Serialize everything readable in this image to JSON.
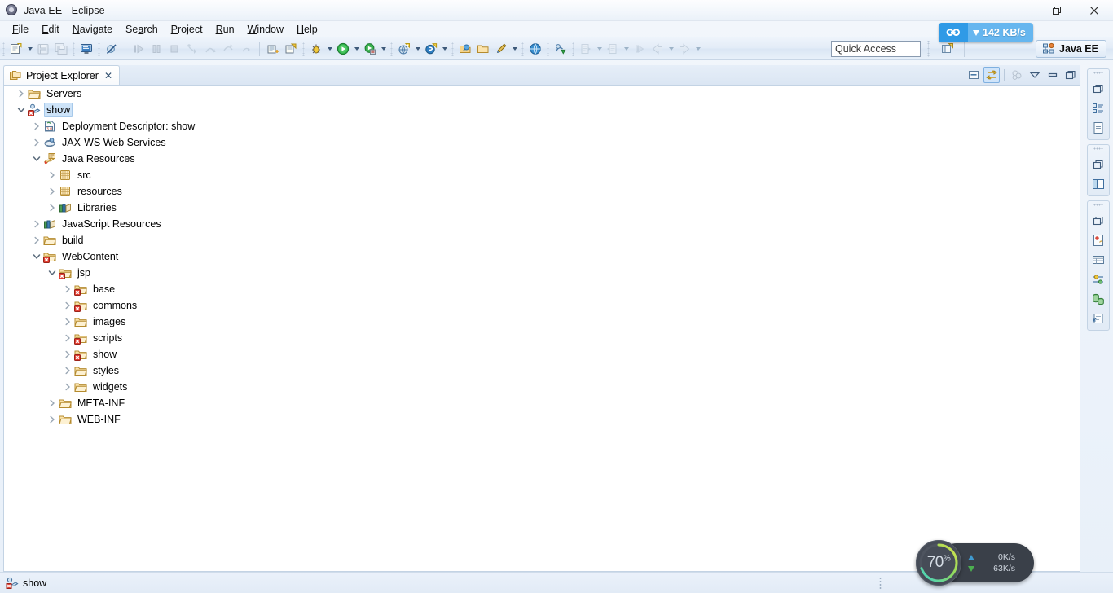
{
  "window": {
    "title": "Java EE - Eclipse",
    "app_icon": "eclipse-logo-icon",
    "minimize_label": "Minimize",
    "maximize_label": "Restore",
    "close_label": "Close"
  },
  "menubar": {
    "items": [
      {
        "label": "File",
        "mnemonic": "F"
      },
      {
        "label": "Edit",
        "mnemonic": "E"
      },
      {
        "label": "Navigate",
        "mnemonic": "N"
      },
      {
        "label": "Search",
        "mnemonic": "a"
      },
      {
        "label": "Project",
        "mnemonic": "P"
      },
      {
        "label": "Run",
        "mnemonic": "R"
      },
      {
        "label": "Window",
        "mnemonic": "W"
      },
      {
        "label": "Help",
        "mnemonic": "H"
      }
    ]
  },
  "toolbar": {
    "groups": [
      {
        "items": [
          {
            "name": "new-wizard-icon",
            "tip": "New",
            "enabled": true,
            "dropdown": true
          },
          {
            "name": "save-icon",
            "tip": "Save",
            "enabled": false,
            "dropdown": false
          },
          {
            "name": "save-all-icon",
            "tip": "Save All",
            "enabled": false,
            "dropdown": false
          }
        ]
      },
      {
        "items": [
          {
            "name": "console-icon",
            "tip": "Open Console",
            "enabled": true,
            "dropdown": false
          }
        ]
      },
      {
        "items": [
          {
            "name": "skip-breakpoints-icon",
            "tip": "Skip All Breakpoints",
            "enabled": true,
            "dropdown": false
          }
        ]
      },
      {
        "items": [
          {
            "name": "resume-icon",
            "tip": "Resume",
            "enabled": false,
            "dropdown": false
          },
          {
            "name": "suspend-icon",
            "tip": "Suspend",
            "enabled": false,
            "dropdown": false
          },
          {
            "name": "terminate-icon",
            "tip": "Terminate",
            "enabled": false,
            "dropdown": false
          },
          {
            "name": "step-into-icon",
            "tip": "Step Into",
            "enabled": false,
            "dropdown": false
          },
          {
            "name": "step-over-icon",
            "tip": "Step Over",
            "enabled": false,
            "dropdown": false
          },
          {
            "name": "step-return-icon",
            "tip": "Step Return",
            "enabled": false,
            "dropdown": false
          },
          {
            "name": "drop-to-frame-icon",
            "tip": "Drop to Frame",
            "enabled": false,
            "dropdown": false
          }
        ]
      },
      {
        "items": [
          {
            "name": "new-java-class-icon",
            "tip": "New Java Class",
            "enabled": true,
            "dropdown": false
          },
          {
            "name": "new-annotation-icon",
            "tip": "New Annotation",
            "enabled": true,
            "dropdown": false
          }
        ]
      },
      {
        "items": [
          {
            "name": "debug-icon",
            "tip": "Debug",
            "enabled": true,
            "dropdown": true
          },
          {
            "name": "run-icon",
            "tip": "Run",
            "enabled": true,
            "dropdown": true
          },
          {
            "name": "run-server-icon",
            "tip": "Run on Server",
            "enabled": true,
            "dropdown": true
          }
        ]
      },
      {
        "items": [
          {
            "name": "new-web-project-icon",
            "tip": "New Web Project",
            "enabled": true,
            "dropdown": true
          },
          {
            "name": "new-server-icon",
            "tip": "New Server",
            "enabled": true,
            "dropdown": true
          }
        ]
      },
      {
        "items": [
          {
            "name": "open-type-icon",
            "tip": "Open Type",
            "enabled": true,
            "dropdown": false
          },
          {
            "name": "open-resource-icon",
            "tip": "Open Resource",
            "enabled": true,
            "dropdown": false
          },
          {
            "name": "search-pencil-icon",
            "tip": "Search",
            "enabled": true,
            "dropdown": true
          }
        ]
      },
      {
        "items": [
          {
            "name": "open-web-browser-icon",
            "tip": "Open Web Browser",
            "enabled": true,
            "dropdown": false
          }
        ]
      },
      {
        "items": [
          {
            "name": "run-last-tool-icon",
            "tip": "External Tools",
            "enabled": true,
            "dropdown": false
          }
        ]
      },
      {
        "items": [
          {
            "name": "previous-edit-icon",
            "tip": "Previous Annotation",
            "enabled": false,
            "dropdown": true
          },
          {
            "name": "next-edit-icon",
            "tip": "Next Annotation",
            "enabled": false,
            "dropdown": true
          }
        ]
      },
      {
        "items": [
          {
            "name": "last-edit-location-icon",
            "tip": "Last Edit Location",
            "enabled": false,
            "dropdown": false
          },
          {
            "name": "back-icon",
            "tip": "Back",
            "enabled": false,
            "dropdown": true
          },
          {
            "name": "forward-icon",
            "tip": "Forward",
            "enabled": false,
            "dropdown": true
          }
        ]
      }
    ]
  },
  "quick_access": {
    "placeholder": "Quick Access",
    "value": ""
  },
  "perspective": {
    "open_perspective_icon": "open-perspective-icon",
    "active": {
      "label": "Java EE",
      "icon": "java-ee-perspective-icon"
    }
  },
  "net_badge": {
    "logo_icon": "network-monitor-icon",
    "direction_icon": "download-arrow-icon",
    "speed": "142 KB/s",
    "accent": "#2f9ae6",
    "background": "#66b6ef"
  },
  "project_explorer": {
    "tab": {
      "title": "Project Explorer",
      "icon": "project-explorer-icon",
      "close_label": "✕"
    },
    "view_toolbar": [
      {
        "name": "collapse-all-icon",
        "tip": "Collapse All",
        "active": false
      },
      {
        "name": "link-with-editor-icon",
        "tip": "Link with Editor",
        "active": true
      },
      {
        "name": "view-menu-filter-icon",
        "tip": "Customize View",
        "active": false
      },
      {
        "name": "view-menu-icon",
        "tip": "View Menu",
        "active": false
      },
      {
        "name": "minimize-view-icon",
        "tip": "Minimize",
        "active": false
      },
      {
        "name": "maximize-view-icon",
        "tip": "Maximize",
        "active": false
      }
    ],
    "tree": [
      {
        "label": "Servers",
        "depth": 0,
        "state": "collapsed",
        "icon": "folder-icon",
        "selected": false,
        "error": false
      },
      {
        "label": "show",
        "depth": 0,
        "state": "expanded",
        "icon": "dynamic-web-project-icon",
        "selected": true,
        "error": true
      },
      {
        "label": "Deployment Descriptor: show",
        "depth": 1,
        "state": "collapsed",
        "icon": "deployment-descriptor-icon",
        "selected": false,
        "error": false
      },
      {
        "label": "JAX-WS Web Services",
        "depth": 1,
        "state": "collapsed",
        "icon": "web-services-icon",
        "selected": false,
        "error": false
      },
      {
        "label": "Java Resources",
        "depth": 1,
        "state": "expanded",
        "icon": "java-resources-icon",
        "selected": false,
        "error": false
      },
      {
        "label": "src",
        "depth": 2,
        "state": "collapsed",
        "icon": "source-folder-icon",
        "selected": false,
        "error": false
      },
      {
        "label": "resources",
        "depth": 2,
        "state": "collapsed",
        "icon": "source-folder-icon",
        "selected": false,
        "error": false
      },
      {
        "label": "Libraries",
        "depth": 2,
        "state": "collapsed",
        "icon": "library-icon",
        "selected": false,
        "error": false
      },
      {
        "label": "JavaScript Resources",
        "depth": 1,
        "state": "collapsed",
        "icon": "library-icon",
        "selected": false,
        "error": false
      },
      {
        "label": "build",
        "depth": 1,
        "state": "collapsed",
        "icon": "folder-icon",
        "selected": false,
        "error": false
      },
      {
        "label": "WebContent",
        "depth": 1,
        "state": "expanded",
        "icon": "web-folder-icon",
        "selected": false,
        "error": true
      },
      {
        "label": "jsp",
        "depth": 2,
        "state": "expanded",
        "icon": "web-folder-icon",
        "selected": false,
        "error": true
      },
      {
        "label": "base",
        "depth": 3,
        "state": "collapsed",
        "icon": "web-folder-icon",
        "selected": false,
        "error": true
      },
      {
        "label": "commons",
        "depth": 3,
        "state": "collapsed",
        "icon": "web-folder-icon",
        "selected": false,
        "error": true
      },
      {
        "label": "images",
        "depth": 3,
        "state": "collapsed",
        "icon": "folder-icon",
        "selected": false,
        "error": false
      },
      {
        "label": "scripts",
        "depth": 3,
        "state": "collapsed",
        "icon": "web-folder-icon",
        "selected": false,
        "error": true
      },
      {
        "label": "show",
        "depth": 3,
        "state": "collapsed",
        "icon": "web-folder-icon",
        "selected": false,
        "error": true
      },
      {
        "label": "styles",
        "depth": 3,
        "state": "collapsed",
        "icon": "folder-icon",
        "selected": false,
        "error": false
      },
      {
        "label": "widgets",
        "depth": 3,
        "state": "collapsed",
        "icon": "folder-icon",
        "selected": false,
        "error": false
      },
      {
        "label": "META-INF",
        "depth": 2,
        "state": "collapsed",
        "icon": "folder-icon",
        "selected": false,
        "error": false
      },
      {
        "label": "WEB-INF",
        "depth": 2,
        "state": "collapsed",
        "icon": "folder-icon",
        "selected": false,
        "error": false
      }
    ]
  },
  "fast_view_bar": {
    "groups": [
      {
        "items": [
          {
            "name": "restore-group-icon",
            "tip": "Restore"
          },
          {
            "name": "outline-view-icon",
            "tip": "Outline"
          },
          {
            "name": "task-list-view-icon",
            "tip": "Task List"
          }
        ]
      },
      {
        "items": [
          {
            "name": "restore-group-icon",
            "tip": "Restore"
          },
          {
            "name": "palette-view-icon",
            "tip": "Palette"
          }
        ]
      },
      {
        "items": [
          {
            "name": "restore-group-icon",
            "tip": "Restore"
          },
          {
            "name": "problems-view-icon",
            "tip": "Problems"
          },
          {
            "name": "servers-view-icon",
            "tip": "Servers"
          },
          {
            "name": "properties-view-icon",
            "tip": "Properties"
          },
          {
            "name": "data-source-view-icon",
            "tip": "Data Source Explorer"
          },
          {
            "name": "snippets-view-icon",
            "tip": "Snippets"
          }
        ]
      }
    ]
  },
  "statusbar": {
    "icon": "dynamic-web-project-icon",
    "text": "show",
    "resize_grip": "status-resize-grip"
  },
  "perf_widget": {
    "cpu_percent": "70",
    "percent_symbol": "%",
    "upload": {
      "arrow": "upload-arrow-icon",
      "value": "0K/s"
    },
    "download": {
      "arrow": "download-arrow-icon",
      "value": "63K/s"
    },
    "ring_color_start": "#3fd2c8",
    "ring_color_end": "#c8e04a",
    "body_color": "#3a4049"
  }
}
